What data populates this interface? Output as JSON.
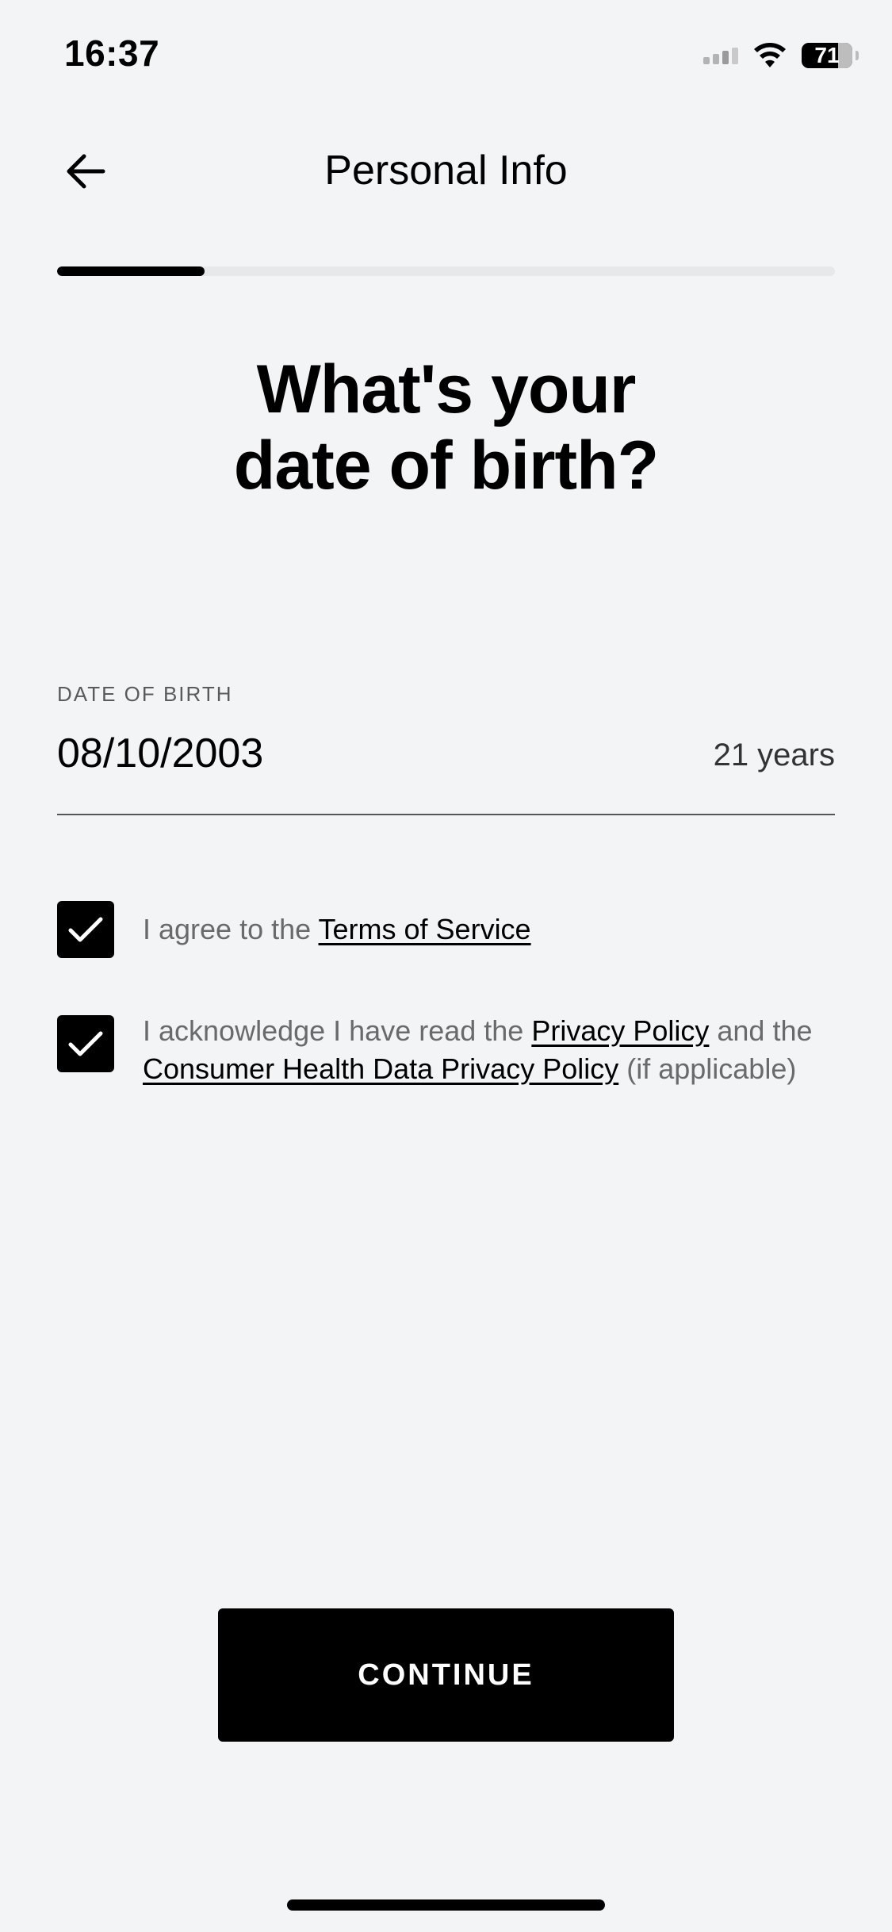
{
  "status_bar": {
    "time": "16:37",
    "battery_percent": "71",
    "icons": [
      "cellular-signal-icon",
      "wifi-icon",
      "battery-icon"
    ]
  },
  "header": {
    "back_icon": "arrow-left-icon",
    "title": "Personal Info"
  },
  "progress": {
    "fraction": 0.19
  },
  "question": {
    "line1": "What's your",
    "line2": "date of birth?"
  },
  "dob_field": {
    "label": "DATE OF BIRTH",
    "value": "08/10/2003",
    "age": "21 years"
  },
  "consents": {
    "terms": {
      "checked": true,
      "prefix": "I agree to the ",
      "link": "Terms of Service"
    },
    "privacy": {
      "checked": true,
      "prefix": "I acknowledge I have read the ",
      "link1": "Privacy Policy",
      "middle": " and the ",
      "link2": "Consumer Health Data Privacy Policy",
      "suffix": " (if applicable)"
    }
  },
  "continue_button": {
    "label": "CONTINUE"
  },
  "colors": {
    "background": "#f3f4f6",
    "primary": "#000000",
    "muted_text": "#6a6a6a",
    "progress_track": "#e6e8ea"
  }
}
